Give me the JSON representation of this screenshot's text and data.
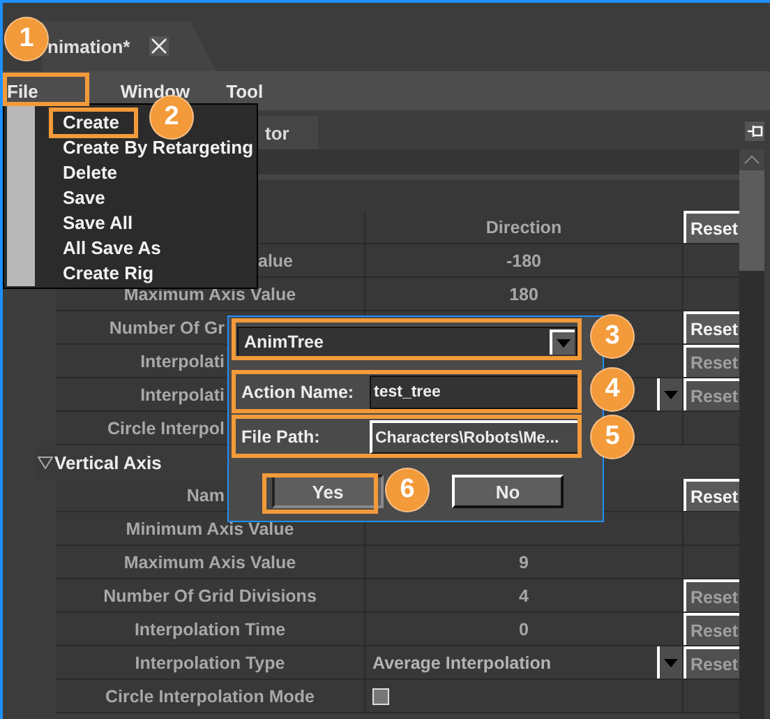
{
  "document_tab": {
    "label": "nimation*"
  },
  "menu_bar": [
    {
      "label": "File"
    },
    {
      "label": "Window"
    },
    {
      "label": "Tool"
    }
  ],
  "file_menu": [
    {
      "label": "Create"
    },
    {
      "label": "Create By Retargeting"
    },
    {
      "label": "Delete"
    },
    {
      "label": "Save"
    },
    {
      "label": "Save All"
    },
    {
      "label": "All Save As"
    },
    {
      "label": "Create Rig"
    }
  ],
  "panel_tab": {
    "label": "tor"
  },
  "horizontal_table": {
    "column": "Direction",
    "reset": "Reset",
    "rows": [
      {
        "label": "alue",
        "clipped_left": true,
        "kind": "number",
        "value": "-180"
      },
      {
        "label": "Maximum Axis Value",
        "kind": "number",
        "value": "180"
      },
      {
        "label": "Number Of Gr",
        "clipped_right": true,
        "kind": "blank",
        "reset": {
          "label": "Reset",
          "disabled": false
        }
      },
      {
        "label": "Interpolati",
        "clipped_right": true,
        "kind": "blank",
        "reset": {
          "label": "Reset",
          "disabled": true
        }
      },
      {
        "label": "Interpolati",
        "clipped_right": true,
        "kind": "dropdown",
        "reset": {
          "label": "Reset",
          "disabled": true
        }
      },
      {
        "label": "Circle Interpol",
        "clipped_right": true,
        "kind": "blank"
      }
    ]
  },
  "vertical_axis": {
    "title": "Vertical Axis",
    "expanded": true,
    "rows": [
      {
        "label": "Nam",
        "clipped_right": true,
        "kind": "blank",
        "reset": {
          "label": "Reset",
          "disabled": false
        }
      },
      {
        "label": "Minimum Axis Value",
        "kind": "blank"
      },
      {
        "label": "Maximum Axis Value",
        "kind": "number",
        "value": "9"
      },
      {
        "label": "Number Of Grid Divisions",
        "kind": "number",
        "value": "4",
        "reset": {
          "label": "Reset",
          "disabled": true
        }
      },
      {
        "label": "Interpolation Time",
        "kind": "number",
        "value": "0",
        "reset": {
          "label": "Reset",
          "disabled": true
        }
      },
      {
        "label": "Interpolation Type",
        "kind": "dropdown",
        "value": "Average Interpolation",
        "reset": {
          "label": "Reset",
          "disabled": true
        }
      },
      {
        "label": "Circle Interpolation Mode",
        "kind": "checkbox",
        "checked": false
      }
    ]
  },
  "dialog": {
    "combo": {
      "value": "AnimTree"
    },
    "fields": [
      {
        "label": "Action Name:",
        "value": "test_tree",
        "kind": "text"
      },
      {
        "label": "File Path:",
        "value": "Characters\\Robots\\Me...",
        "kind": "browse"
      }
    ],
    "buttons": [
      {
        "label": "Yes",
        "default": true
      },
      {
        "label": "No",
        "default": false
      }
    ]
  },
  "callouts": [
    {
      "label": "1"
    },
    {
      "label": "2"
    },
    {
      "label": "3"
    },
    {
      "label": "4"
    },
    {
      "label": "5"
    },
    {
      "label": "6"
    }
  ]
}
